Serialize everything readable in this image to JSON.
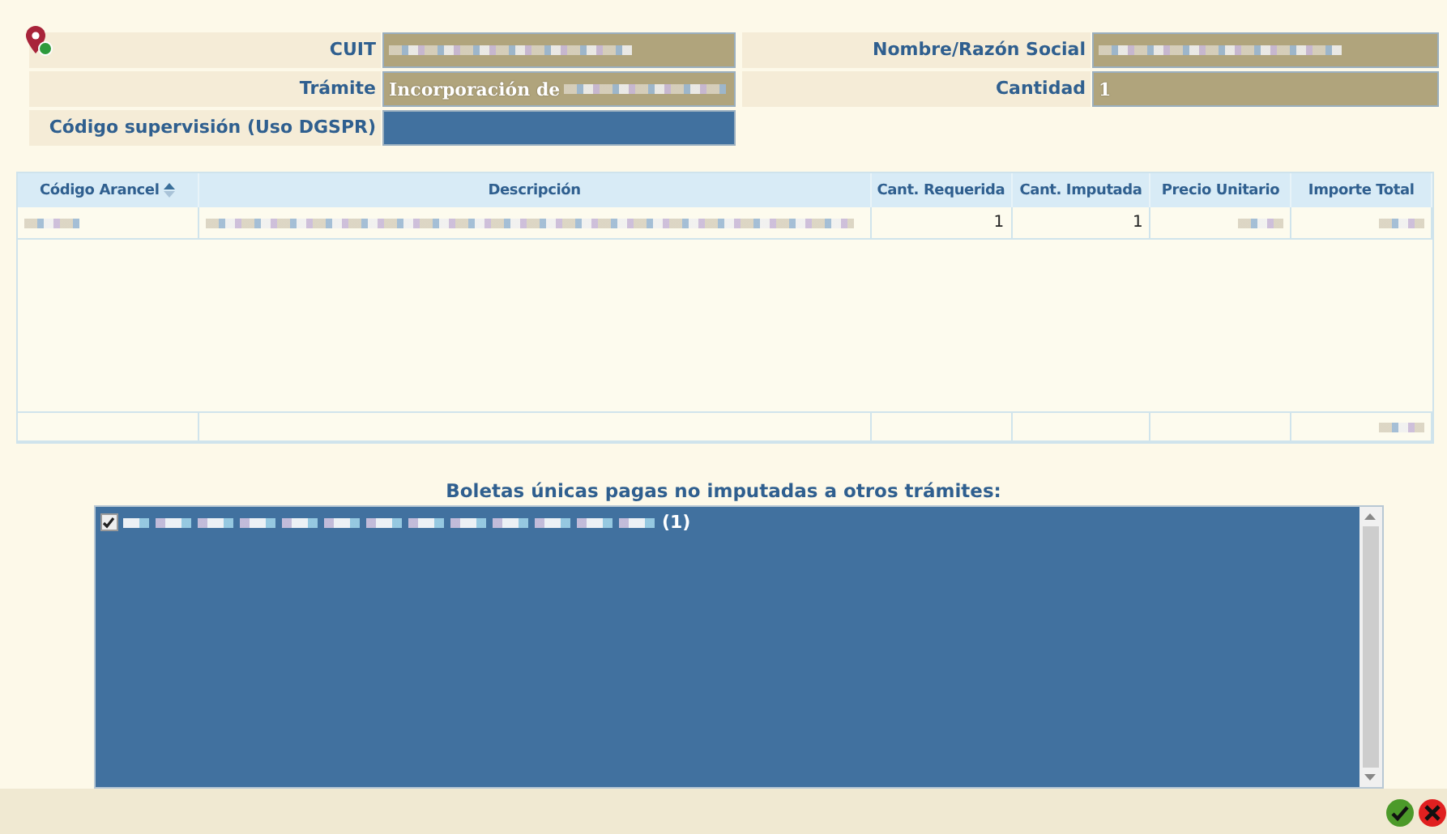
{
  "form": {
    "left": [
      {
        "label": "CUIT",
        "redacted": true,
        "kind": "readonly"
      },
      {
        "label": "Trámite",
        "value": "Incorporación de",
        "redacted": true,
        "kind": "readonly"
      },
      {
        "label": "Código supervisión (Uso DGSPR)",
        "redacted": false,
        "kind": "editable"
      }
    ],
    "right": [
      {
        "label": "Nombre/Razón Social",
        "redacted": true,
        "kind": "readonly"
      },
      {
        "label": "Cantidad",
        "value": "1",
        "redacted": false,
        "kind": "readonly"
      }
    ]
  },
  "table": {
    "columns": [
      {
        "label": "Código Arancel",
        "sorted": true
      },
      {
        "label": "Descripción",
        "sorted": false
      },
      {
        "label": "Cant. Requerida",
        "sorted": false
      },
      {
        "label": "Cant. Imputada",
        "sorted": false
      },
      {
        "label": "Precio Unitario",
        "sorted": false
      },
      {
        "label": "Importe Total",
        "sorted": false
      }
    ],
    "rows": [
      [
        {
          "redacted": true
        },
        {
          "redacted": true
        },
        {
          "value": "1",
          "redacted": false
        },
        {
          "value": "1",
          "redacted": false
        },
        {
          "redacted": true
        },
        {
          "redacted": true
        }
      ]
    ],
    "footer": [
      {
        "redacted": false
      },
      {
        "redacted": false
      },
      {
        "redacted": false
      },
      {
        "redacted": false
      },
      {
        "redacted": false
      },
      {
        "redacted": true
      }
    ]
  },
  "boletas": {
    "title": "Boletas únicas pagas no imputadas a otros trámites:",
    "items": [
      {
        "checked": true,
        "redacted": true,
        "suffix": "(1)"
      }
    ]
  }
}
